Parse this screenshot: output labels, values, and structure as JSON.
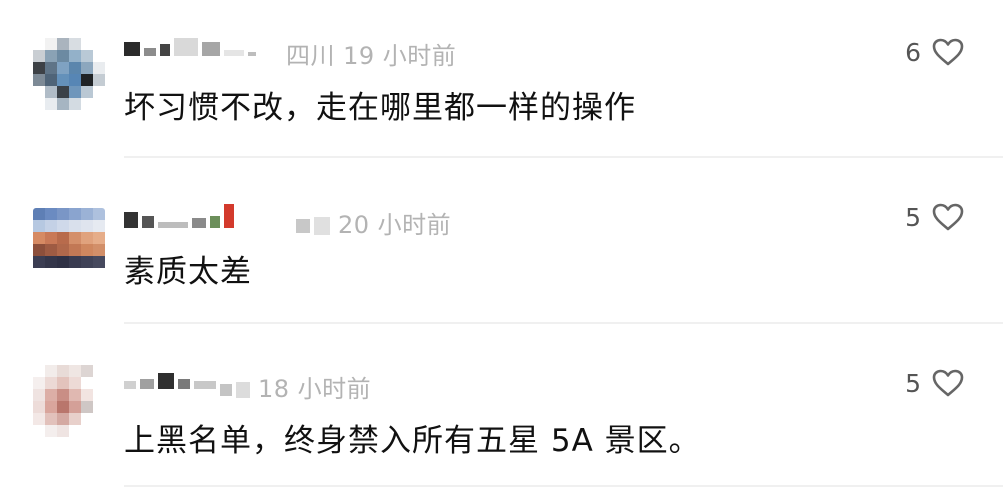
{
  "comments": [
    {
      "time_label": "19 小时前",
      "location": "四川",
      "text": "坏习惯不改，走在哪里都一样的操作",
      "likes": "6"
    },
    {
      "time_label": "20 小时前",
      "text": "素质太差",
      "likes": "5"
    },
    {
      "time_label": "18 小时前",
      "text": "上黑名单，终身禁入所有五星 5A 景区。",
      "likes": "5"
    }
  ],
  "icons": {
    "like": "heart-outline-icon"
  },
  "colors": {
    "meta_text": "#b3b3b3",
    "body_text": "#111111",
    "like_count": "#555555"
  }
}
